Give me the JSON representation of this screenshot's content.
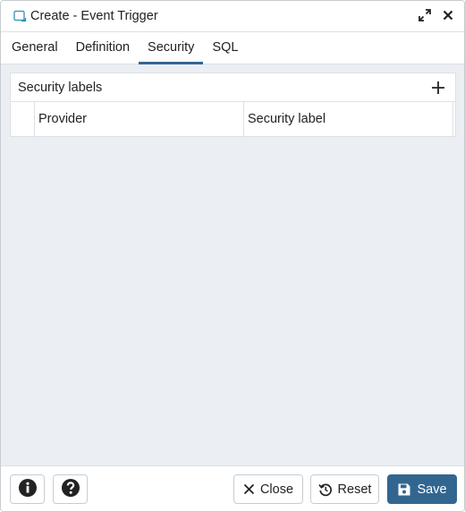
{
  "dialog": {
    "title": "Create - Event Trigger",
    "icons": {
      "title": "event-trigger-icon",
      "maximize": "maximize-icon",
      "close": "close-icon"
    }
  },
  "tabs": [
    {
      "label": "General",
      "active": false
    },
    {
      "label": "Definition",
      "active": false
    },
    {
      "label": "Security",
      "active": true
    },
    {
      "label": "SQL",
      "active": false
    }
  ],
  "security_labels": {
    "title": "Security labels",
    "add_icon": "plus-icon",
    "columns": [
      "Provider",
      "Security label"
    ],
    "rows": []
  },
  "footer": {
    "info_icon": "info-icon",
    "help_icon": "help-icon",
    "close_label": "Close",
    "reset_label": "Reset",
    "save_label": "Save"
  },
  "colors": {
    "accent": "#326690",
    "content_bg": "#ebeef3",
    "border": "#dde0e5"
  }
}
